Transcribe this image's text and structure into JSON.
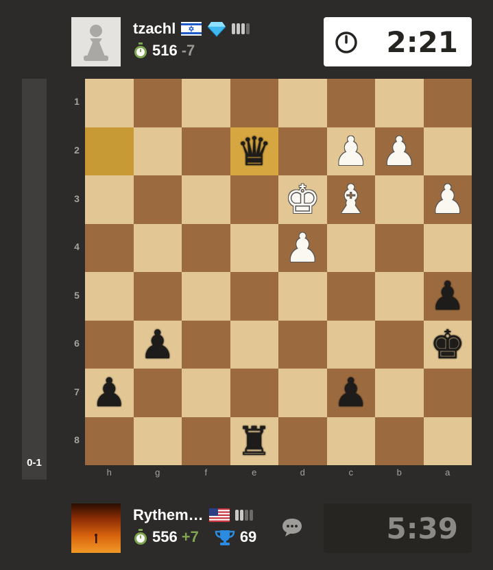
{
  "top_player": {
    "name": "tzachl",
    "flag": "israel-flag-icon",
    "badge": "diamond-icon",
    "rating": "516",
    "rating_change": "-7"
  },
  "bottom_player": {
    "name": "Rythem…",
    "flag": "usa-flag-icon",
    "rating": "556",
    "rating_change": "+7",
    "trophy_score": "69"
  },
  "clocks": {
    "top": "2:21",
    "bottom": "5:39"
  },
  "eval_bar": {
    "score": "0-1"
  },
  "board": {
    "ranks": [
      "1",
      "2",
      "3",
      "4",
      "5",
      "6",
      "7",
      "8"
    ],
    "files": [
      "h",
      "g",
      "f",
      "e",
      "d",
      "c",
      "b",
      "a"
    ],
    "squares": [
      [
        "",
        "",
        "",
        "",
        "",
        "",
        "",
        ""
      ],
      [
        "",
        "",
        "",
        "q",
        "",
        "P",
        "P",
        ""
      ],
      [
        "",
        "",
        "",
        "",
        "K",
        "B",
        "",
        "P"
      ],
      [
        "",
        "",
        "",
        "",
        "P",
        "",
        "",
        ""
      ],
      [
        "",
        "",
        "",
        "",
        "",
        "",
        "",
        "p"
      ],
      [
        "",
        "p",
        "",
        "",
        "",
        "",
        "",
        "k"
      ],
      [
        "p",
        "",
        "",
        "",
        "",
        "p",
        "",
        ""
      ],
      [
        "",
        "",
        "",
        "r",
        "",
        "",
        "",
        ""
      ]
    ],
    "highlighted": [
      "h2",
      "e2"
    ]
  },
  "colors": {
    "light_square": "#e2c795",
    "dark_square": "#9b6b3f",
    "highlight": "#c89a35",
    "background": "#2c2b29"
  }
}
